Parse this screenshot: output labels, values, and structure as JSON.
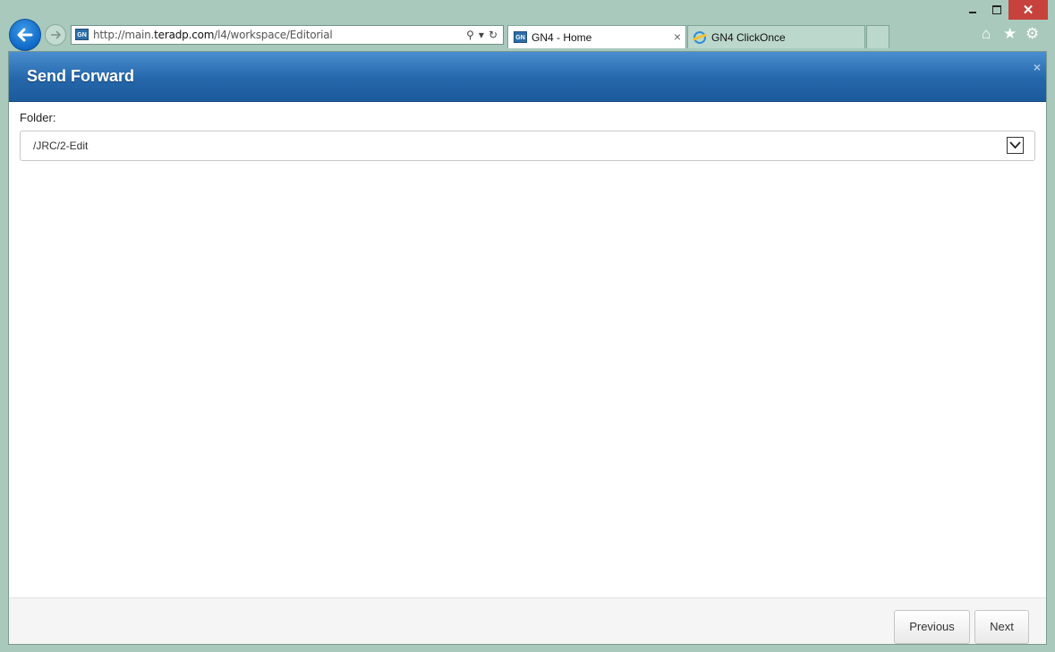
{
  "browser": {
    "url_prefix": "http://main.",
    "url_domain": "teradp.com",
    "url_path": "/l4/workspace/Editorial",
    "favicon_text": "GN",
    "tabs": [
      {
        "label": "GN4 - Home",
        "active": true
      },
      {
        "label": "GN4 ClickOnce",
        "active": false
      }
    ],
    "tab_close_glyph": "×",
    "window_close_glyph": "✕",
    "icons": [
      "back-arrow-icon",
      "forward-arrow-icon",
      "search-icon",
      "dropdown-icon",
      "refresh-icon",
      "home-icon",
      "star-icon",
      "gear-icon"
    ]
  },
  "dialog": {
    "title": "Send Forward",
    "close_glyph": "×",
    "folder_label": "Folder:",
    "folder_value": "/JRC/2-Edit",
    "previous_label": "Previous",
    "next_label": "Next"
  },
  "colors": {
    "header_blue": "#2567ab",
    "chrome_green": "#a9c9bd",
    "window_close_red": "#c7423c"
  }
}
